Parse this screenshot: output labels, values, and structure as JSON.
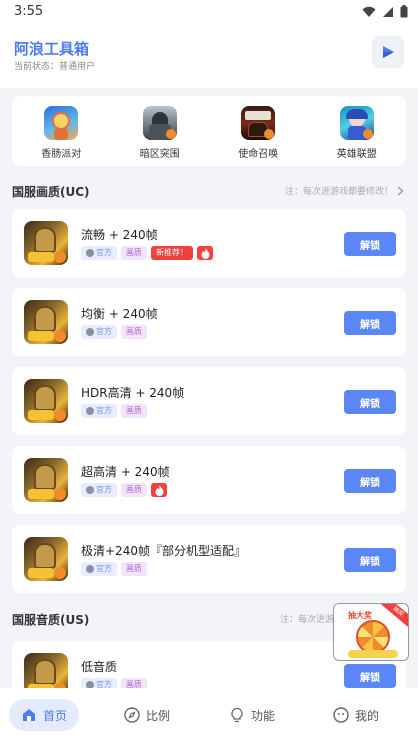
{
  "status_bar": {
    "time": "3:55"
  },
  "header": {
    "title": "阿浪工具箱",
    "subtitle": "当前状态：普通用户"
  },
  "games": [
    {
      "name": "香肠派对",
      "icon": "sausage-party-game-icon"
    },
    {
      "name": "暗区突围",
      "icon": "arena-breakout-game-icon"
    },
    {
      "name": "使命召唤",
      "icon": "call-of-duty-game-icon"
    },
    {
      "name": "英雄联盟",
      "icon": "league-of-legends-game-icon"
    }
  ],
  "section_cn": {
    "title": "国服画质(UC)",
    "note": "注：每次进游戏都要修改！"
  },
  "section_us": {
    "title": "国服音质(US)",
    "note": "注：每次进游"
  },
  "tag_labels": {
    "official": "官方",
    "quality": "画质",
    "new": "新推荐！"
  },
  "presets": [
    {
      "name": "流畅 + 240帧",
      "tags": [
        "official",
        "quality",
        "new",
        "fire"
      ],
      "button": "解锁"
    },
    {
      "name": "均衡 + 240帧",
      "tags": [
        "official",
        "quality"
      ],
      "button": "解锁"
    },
    {
      "name": "HDR高清 + 240帧",
      "tags": [
        "official",
        "quality"
      ],
      "button": "解锁"
    },
    {
      "name": "超高清 + 240帧",
      "tags": [
        "official",
        "quality",
        "fire"
      ],
      "button": "解锁"
    },
    {
      "name": "极清+240帧『部分机型适配』",
      "tags": [
        "official",
        "quality"
      ],
      "button": "解锁"
    },
    {
      "name": "低音质",
      "tags": [
        "official",
        "quality"
      ],
      "button": "解锁"
    }
  ],
  "float_ad": {
    "title": "抽大奖",
    "corner": "抽奖"
  },
  "nav": [
    {
      "label": "首页",
      "icon": "home-icon",
      "active": true
    },
    {
      "label": "比例",
      "icon": "compass-icon",
      "active": false
    },
    {
      "label": "功能",
      "icon": "lightbulb-icon",
      "active": false
    },
    {
      "label": "我的",
      "icon": "smiley-icon",
      "active": false
    }
  ],
  "colors": {
    "accent": "#4c7cf0",
    "button": "#5b86f5",
    "hot": "#f2413d"
  }
}
